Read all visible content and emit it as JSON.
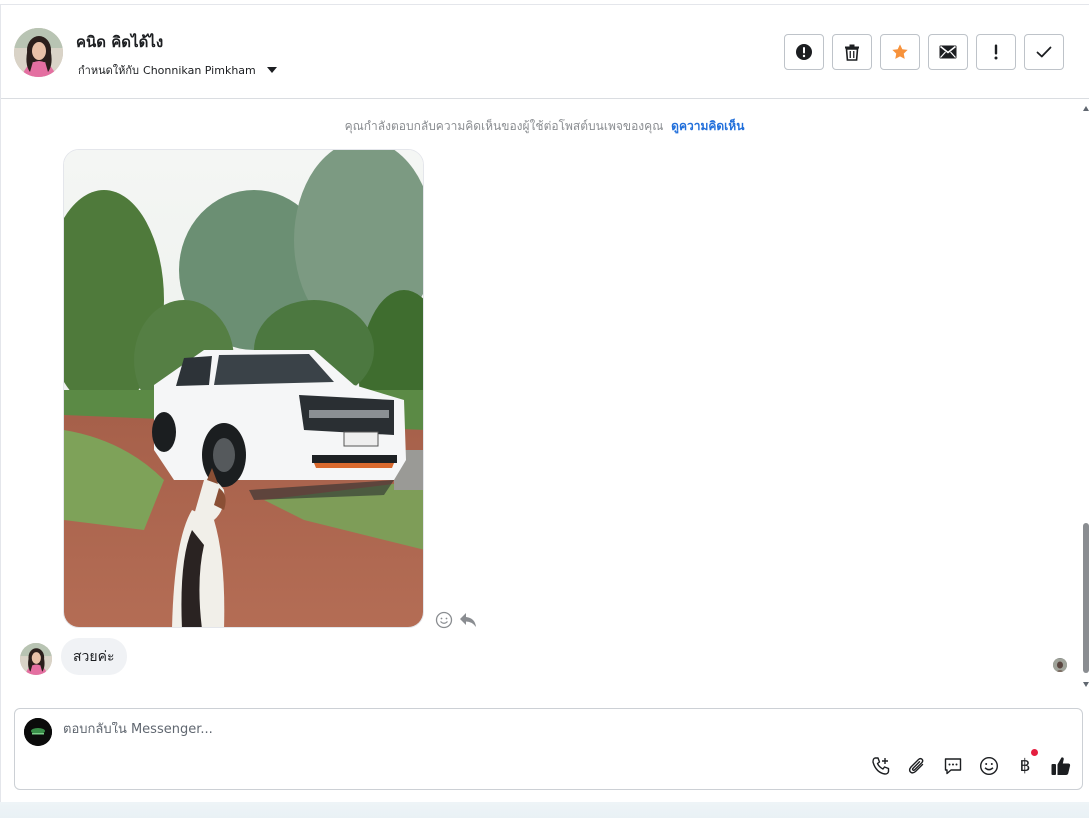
{
  "header": {
    "contact_name": "คนิด คิดได้ไง",
    "assign_label": "กำหนดให้กับ",
    "assignee": "Chonnikan Pimkham",
    "actions": [
      {
        "name": "report-spam-button",
        "icon": "exclamation-circle-icon"
      },
      {
        "name": "delete-button",
        "icon": "trash-icon"
      },
      {
        "name": "star-button",
        "icon": "star-icon",
        "color": "#f7923b"
      },
      {
        "name": "mark-unread-button",
        "icon": "envelope-icon"
      },
      {
        "name": "mark-important-button",
        "icon": "exclamation-icon"
      },
      {
        "name": "mark-done-button",
        "icon": "check-icon"
      }
    ]
  },
  "thread": {
    "notice_text": "คุณกำลังตอบกลับความคิดเห็นของผู้ใช้ต่อโพสต์บนเพจของคุณ",
    "notice_link": "ดูความคิดเห็น",
    "message_text": "สวยค่ะ"
  },
  "composer": {
    "placeholder": "ตอบกลับใน Messenger...",
    "value": "",
    "baht_symbol": "฿",
    "tools": [
      "call-add-icon",
      "paperclip-icon",
      "saved-replies-icon",
      "emoji-icon",
      "baht-icon",
      "like-icon"
    ]
  },
  "colors": {
    "link": "#216fdb",
    "star": "#f7923b",
    "notification_dot": "#e41e3f"
  }
}
